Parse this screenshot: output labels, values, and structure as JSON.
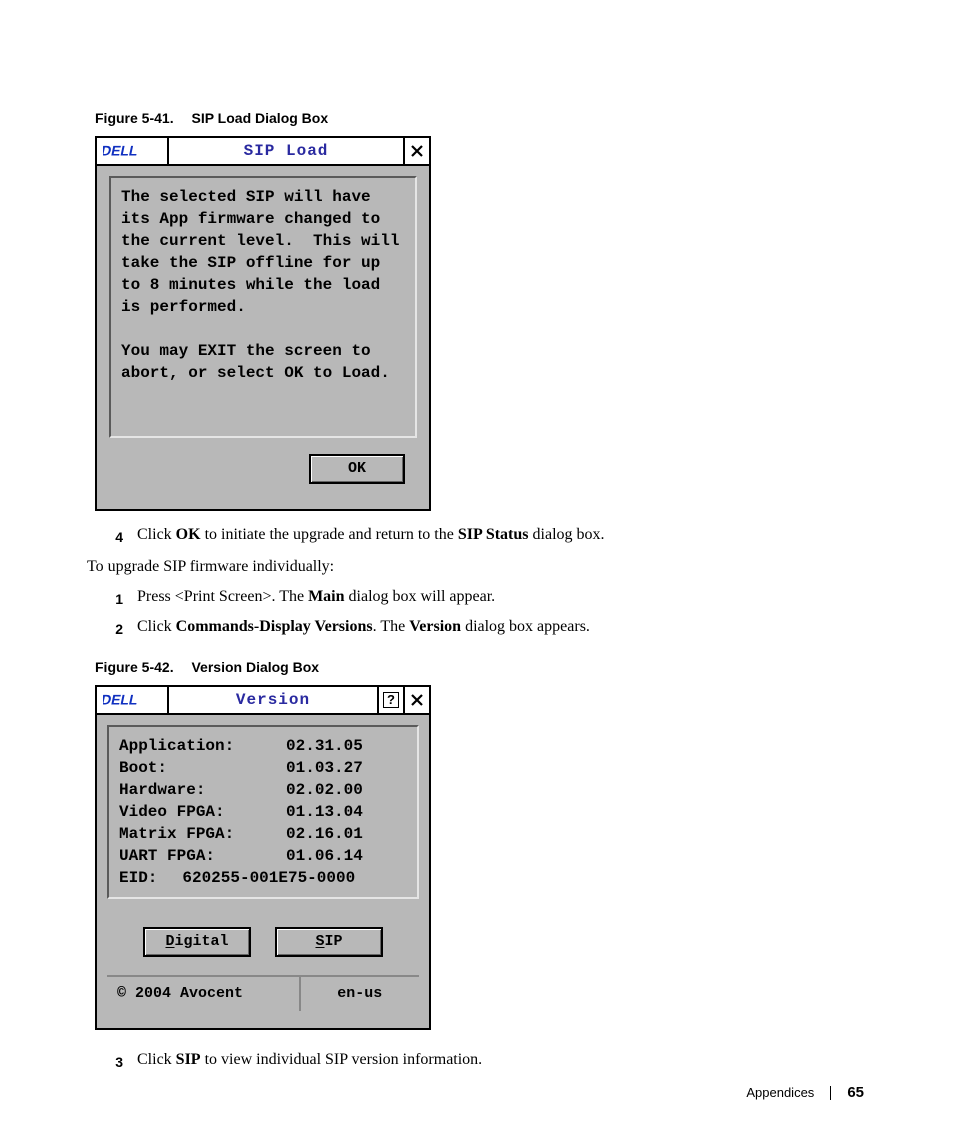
{
  "figures": {
    "f1": {
      "id": "Figure 5-41.",
      "title": "SIP Load Dialog Box"
    },
    "f2": {
      "id": "Figure 5-42.",
      "title": "Version Dialog Box"
    }
  },
  "dialog1": {
    "logo_text": "DELL",
    "title": "SIP Load",
    "close_glyph": "✕",
    "message_p1": "The selected SIP will have its App firmware changed to the current level.  This will take the SIP offline for up to 8 minutes while the load is performed.",
    "message_p2": "You may EXIT the screen to abort, or select OK to Load.",
    "ok_label": "OK"
  },
  "steps_a": {
    "s4": {
      "num": "4",
      "pre": "Click ",
      "b1": "OK",
      "mid": " to initiate the upgrade and return to the ",
      "b2": "SIP Status",
      "post": " dialog box."
    }
  },
  "intro2": "To upgrade SIP firmware individually:",
  "steps_b": {
    "s1": {
      "num": "1",
      "pre": "Press <Print Screen>. The ",
      "b1": "Main",
      "post": " dialog box will appear."
    },
    "s2": {
      "num": "2",
      "pre": "Click ",
      "b1": "Commands-Display Versions",
      "mid": ". The ",
      "b2": "Version",
      "post": " dialog box appears."
    }
  },
  "dialog2": {
    "logo_text": "DELL",
    "title": "Version",
    "help_glyph": "?",
    "close_glyph": "✕",
    "rows": {
      "r0": {
        "label": "Application:",
        "value": "02.31.05"
      },
      "r1": {
        "label": "Boot:",
        "value": "01.03.27"
      },
      "r2": {
        "label": "Hardware:",
        "value": "02.02.00"
      },
      "r3": {
        "label": "Video FPGA:",
        "value": "01.13.04"
      },
      "r4": {
        "label": "Matrix FPGA:",
        "value": "02.16.01"
      },
      "r5": {
        "label": "UART FPGA:",
        "value": "01.06.14"
      }
    },
    "eid_label": "EID:",
    "eid_value": "620255-001E75-0000",
    "btn_digital": "Digital",
    "btn_digital_u": "D",
    "btn_digital_rest": "igital",
    "btn_sip": "SIP",
    "btn_sip_u": "S",
    "btn_sip_rest": "IP",
    "copyright": "© 2004 Avocent",
    "locale": "en-us"
  },
  "steps_c": {
    "s3": {
      "num": "3",
      "pre": "Click ",
      "b1": "SIP",
      "post": " to view individual SIP version information."
    }
  },
  "footer": {
    "section": "Appendices",
    "page": "65"
  }
}
